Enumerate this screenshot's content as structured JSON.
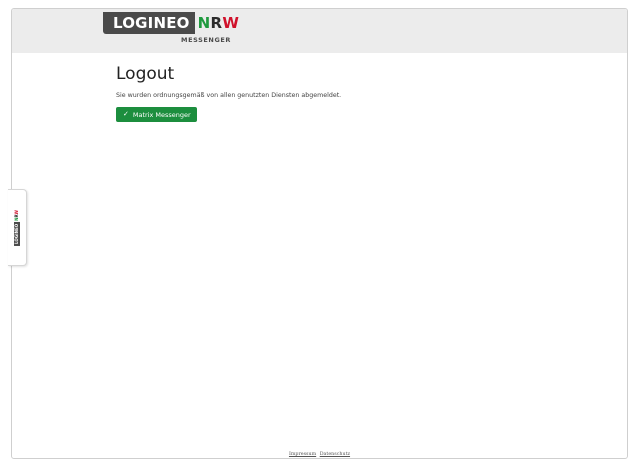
{
  "header": {
    "logo_main": "LOGINEO",
    "logo_nrw_n": "N",
    "logo_nrw_r": "R",
    "logo_nrw_w": "W",
    "logo_sub": "MESSENGER"
  },
  "main": {
    "title": "Logout",
    "message": "Sie wurden ordnungsgemäß von allen genutzten Diensten abgemeldet.",
    "button_label": "Matrix Messenger",
    "button_icon": "check-icon"
  },
  "side_tab": {
    "logo_main": "LOGINEO",
    "logo_nrw_n": "N",
    "logo_nrw_r": "R",
    "logo_nrw_w": "W"
  },
  "footer": {
    "links": [
      "Impressum",
      "Datenschutz"
    ]
  },
  "colors": {
    "brand_dark": "#4a4a4a",
    "brand_green": "#1f9a3e",
    "brand_red": "#d0112b",
    "button_green": "#1c8e3e",
    "header_bg": "#ececec"
  }
}
